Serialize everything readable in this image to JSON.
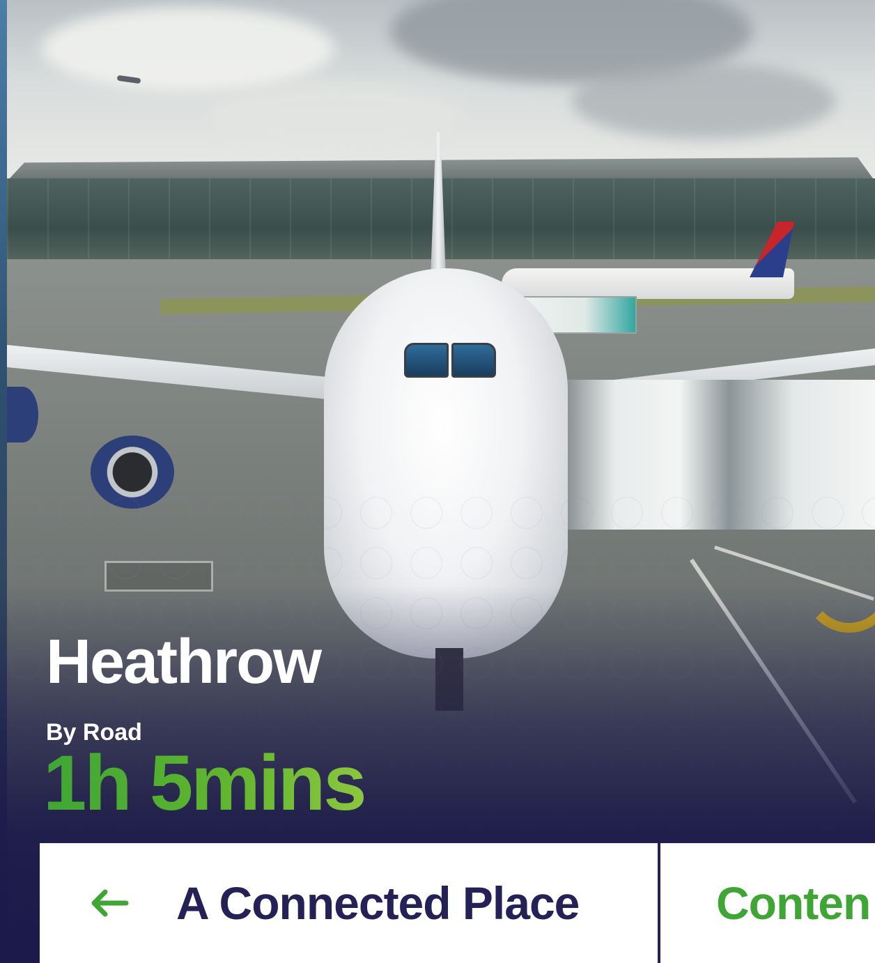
{
  "hero": {
    "title": "Heathrow",
    "mode_label": "By Road",
    "travel_time": "1h 5mins"
  },
  "nav": {
    "prev_label": "A Connected Place",
    "next_label": "Conten"
  },
  "icons": {
    "back": "arrow-left-icon"
  },
  "colors": {
    "navy": "#232155",
    "deep_navy": "#1c1a4a",
    "green": "#3fa535",
    "white": "#ffffff"
  }
}
